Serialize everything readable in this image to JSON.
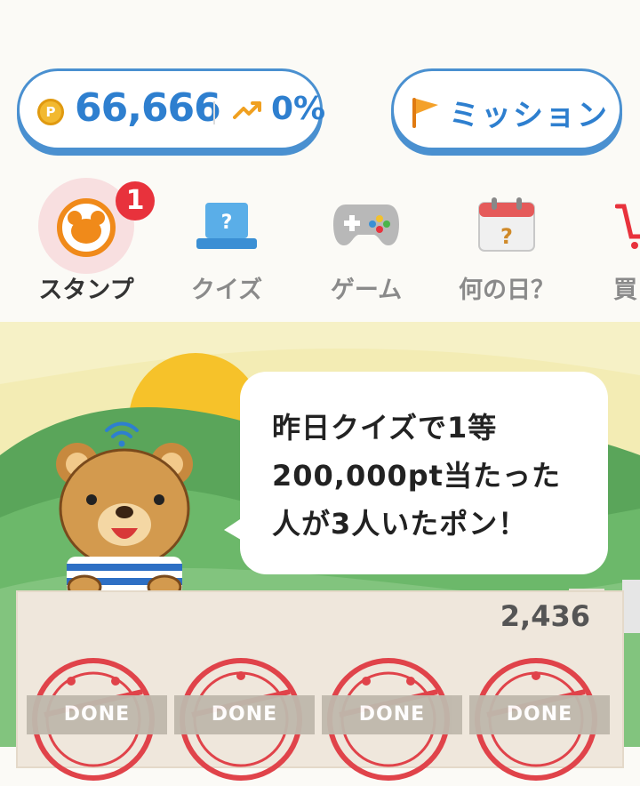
{
  "header": {
    "points": "66,666",
    "coin_symbol": "P",
    "trend_percent": "0%",
    "mission_label": "ミッション"
  },
  "nav": {
    "items": [
      {
        "label": "スタンプ",
        "icon": "bear-stamp-icon",
        "badge": "1"
      },
      {
        "label": "クイズ",
        "icon": "quiz-hat-icon"
      },
      {
        "label": "ゲーム",
        "icon": "gamepad-icon"
      },
      {
        "label": "何の日？",
        "icon": "calendar-icon"
      },
      {
        "label": "買い",
        "icon": "cart-icon"
      }
    ]
  },
  "speech": {
    "line1": "昨日クイズで1等",
    "line2": "200,000pt当たった",
    "line3": "人が3人いたポン！"
  },
  "stamps": {
    "count": "2,436",
    "done_label": "DONE"
  },
  "colors": {
    "accent_blue": "#2e7fcf",
    "badge_red": "#e8323c",
    "stamp_red": "#e0434a"
  }
}
